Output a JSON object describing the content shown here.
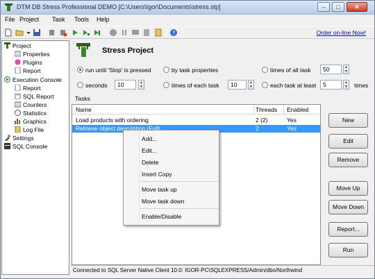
{
  "window": {
    "title": "DTM DB Stress Professional DEMO [C:\\Users\\Igor\\Documents\\stress.stp]",
    "minimize": "–",
    "maximize": "□",
    "close": "✕"
  },
  "menu": [
    "File",
    "Project",
    "Task",
    "Tools",
    "Help"
  ],
  "toolbar": {
    "order_link": "Order on-line Now!"
  },
  "tree": {
    "nodes": [
      {
        "label": "Project",
        "icon": "project-icon"
      },
      {
        "label": "Properties",
        "icon": "properties-icon"
      },
      {
        "label": "Plugins",
        "icon": "plugins-icon"
      },
      {
        "label": "Report",
        "icon": "report-icon"
      },
      {
        "label": "Execution Console",
        "icon": "execution-icon"
      },
      {
        "label": "Report",
        "icon": "report-icon"
      },
      {
        "label": "SQL Report",
        "icon": "sql-report-icon"
      },
      {
        "label": "Counters",
        "icon": "counters-icon"
      },
      {
        "label": "Statistics",
        "icon": "statistics-icon"
      },
      {
        "label": "Graphics",
        "icon": "graphics-icon"
      },
      {
        "label": "Log File",
        "icon": "log-file-icon"
      },
      {
        "label": "Settings",
        "icon": "settings-icon"
      },
      {
        "label": "SQL Console",
        "icon": "sql-console-icon"
      }
    ]
  },
  "main": {
    "title": "Stress Project",
    "options": {
      "run_until_stop": "run until 'Stop' is pressed",
      "by_task_properties": "by task properties",
      "times_of_all_task": "times of all task",
      "times_of_all_task_value": "50",
      "seconds": "seconds",
      "seconds_value": "10",
      "times_of_each_task": "times of each task",
      "times_of_each_task_value": "10",
      "each_task_at_least": "each task at least",
      "each_task_at_least_value": "5",
      "times": "times"
    },
    "tasks_label": "Tasks",
    "columns": [
      "Name",
      "Threads",
      "Enabled"
    ],
    "rows": [
      {
        "name": "Load products with ordering",
        "threads": "2 (2)",
        "enabled": "Yes"
      },
      {
        "name": "Retrieve object description (Full)",
        "threads": "2",
        "enabled": "Yes"
      }
    ],
    "buttons": {
      "new": "New",
      "edit": "Edit",
      "remove": "Remove",
      "move_up": "Move Up",
      "move_down": "Move Down",
      "report": "Report...",
      "run": "Run"
    }
  },
  "context_menu": {
    "items": [
      "Add...",
      "Edit...",
      "Delete",
      "Insert Copy",
      "Move task up",
      "Move task down",
      "Enable/Disable"
    ]
  },
  "status": "Connected to SQL Server Native Client 10.0: IGOR-PC\\SQLEXPRESS/Admin/dbo/Northwind",
  "colors": {
    "selection": "#3399ff",
    "link": "#0000cc"
  }
}
